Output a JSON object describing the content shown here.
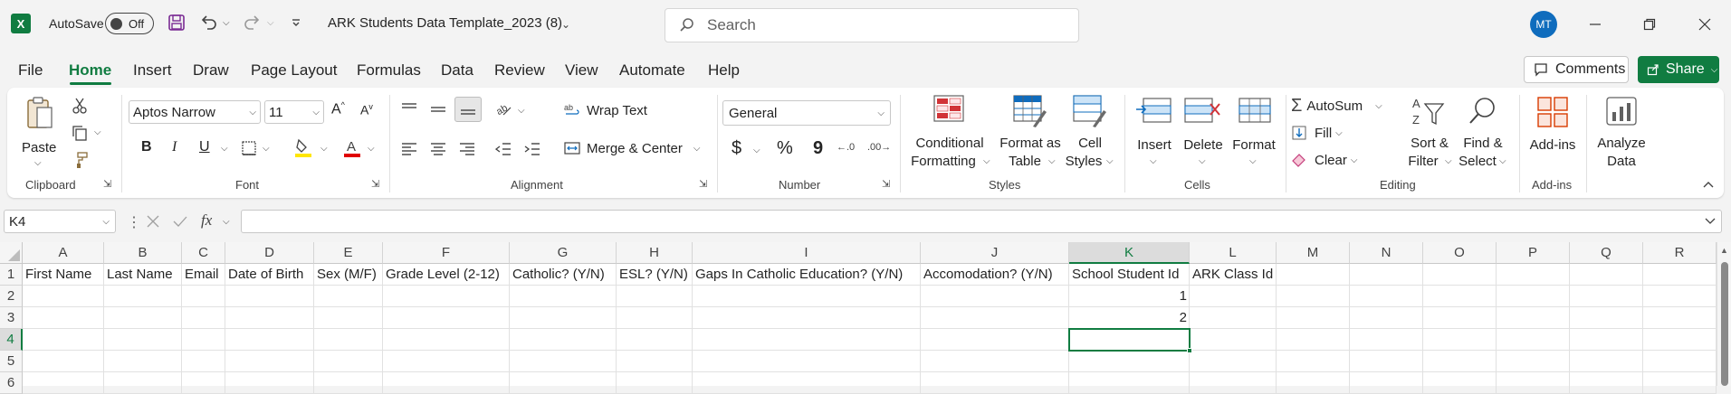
{
  "title_bar": {
    "autosave_label": "AutoSave",
    "autosave_state": "Off",
    "doc_title": "ARK Students Data Template_2023 (8)",
    "search_placeholder": "Search",
    "avatar_initials": "MT"
  },
  "tabs": [
    "File",
    "Home",
    "Insert",
    "Draw",
    "Page Layout",
    "Formulas",
    "Data",
    "Review",
    "View",
    "Automate",
    "Help"
  ],
  "active_tab": "Home",
  "actions": {
    "comments": "Comments",
    "share": "Share"
  },
  "ribbon": {
    "clipboard": {
      "paste": "Paste",
      "group": "Clipboard"
    },
    "font": {
      "name": "Aptos Narrow",
      "size": "11",
      "group": "Font",
      "bold": "B",
      "italic": "I",
      "underline": "U"
    },
    "alignment": {
      "wrap": "Wrap Text",
      "merge": "Merge & Center",
      "group": "Alignment"
    },
    "number": {
      "format": "General",
      "currency": "$",
      "percent": "%",
      "comma": "9",
      "group": "Number"
    },
    "styles": {
      "conditional_1": "Conditional",
      "conditional_2": "Formatting",
      "format_table_1": "Format as",
      "format_table_2": "Table",
      "cell_styles_1": "Cell",
      "cell_styles_2": "Styles",
      "group": "Styles"
    },
    "cells": {
      "insert": "Insert",
      "delete": "Delete",
      "format": "Format",
      "group": "Cells"
    },
    "editing": {
      "autosum": "AutoSum",
      "fill": "Fill",
      "clear": "Clear",
      "sort_1": "Sort &",
      "sort_2": "Filter",
      "find_1": "Find &",
      "find_2": "Select",
      "group": "Editing"
    },
    "addins": {
      "addins": "Add-ins",
      "group": "Add-ins"
    },
    "analyze": {
      "line1": "Analyze",
      "line2": "Data"
    }
  },
  "formula_bar": {
    "name_box": "K4",
    "fx": "fx",
    "formula": ""
  },
  "columns": [
    "A",
    "B",
    "C",
    "D",
    "E",
    "F",
    "G",
    "H",
    "I",
    "J",
    "K",
    "L",
    "M",
    "N",
    "O",
    "P",
    "Q",
    "R"
  ],
  "rows": [
    "1",
    "2",
    "3",
    "4",
    "5",
    "6"
  ],
  "headers": [
    "First Name",
    "Last Name",
    "Email",
    "Date of Birth",
    "Sex (M/F)",
    "Grade Level (2-12)",
    "Catholic? (Y/N)",
    "ESL? (Y/N)",
    "Gaps In Catholic Education? (Y/N)",
    "Accomodation? (Y/N)",
    "School Student Id",
    "ARK Class Id"
  ],
  "k_values": [
    "1",
    "2"
  ],
  "selected_cell": "K4",
  "colors": {
    "accent": "#107c41",
    "selection": "#107c41",
    "avatar": "#0f6cbd"
  }
}
